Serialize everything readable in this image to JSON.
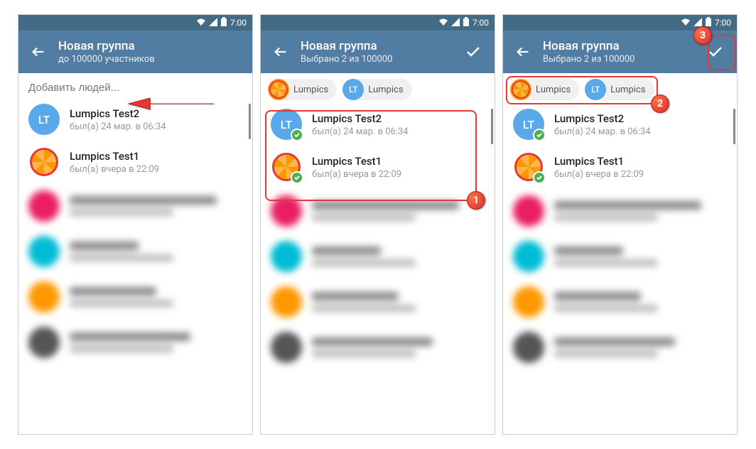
{
  "status": {
    "time": "7:00"
  },
  "screen1": {
    "title": "Новая группа",
    "subtitle": "до 100000 участников",
    "search_placeholder": "Добавить людей...",
    "contacts": [
      {
        "name": "Lumpics Test2",
        "status": "был(а) 24 мар. в 06:34",
        "avatar_text": "LT"
      },
      {
        "name": "Lumpics Test1",
        "status": "был(а) вчера в 22:09"
      }
    ]
  },
  "screen2": {
    "title": "Новая группа",
    "subtitle": "Выбрано 2 из 100000",
    "chip1_label": "Lumpics",
    "chip2_label": "Lumpics",
    "chip2_avatar": "LT",
    "contacts": [
      {
        "name": "Lumpics Test2",
        "status": "был(а) 24 мар. в 06:34",
        "avatar_text": "LT"
      },
      {
        "name": "Lumpics Test1",
        "status": "был(а) вчера в 22:09"
      }
    ]
  },
  "screen3": {
    "title": "Новая группа",
    "subtitle": "Выбрано 2 из 100000",
    "chip1_label": "Lumpics",
    "chip2_label": "Lumpics",
    "chip2_avatar": "LT",
    "contacts": [
      {
        "name": "Lumpics Test2",
        "status": "был(а) 24 мар. в 06:34",
        "avatar_text": "LT"
      },
      {
        "name": "Lumpics Test1",
        "status": "был(а) вчера в 22:09"
      }
    ]
  },
  "steps": {
    "s1": "1",
    "s2": "2",
    "s3": "3"
  }
}
